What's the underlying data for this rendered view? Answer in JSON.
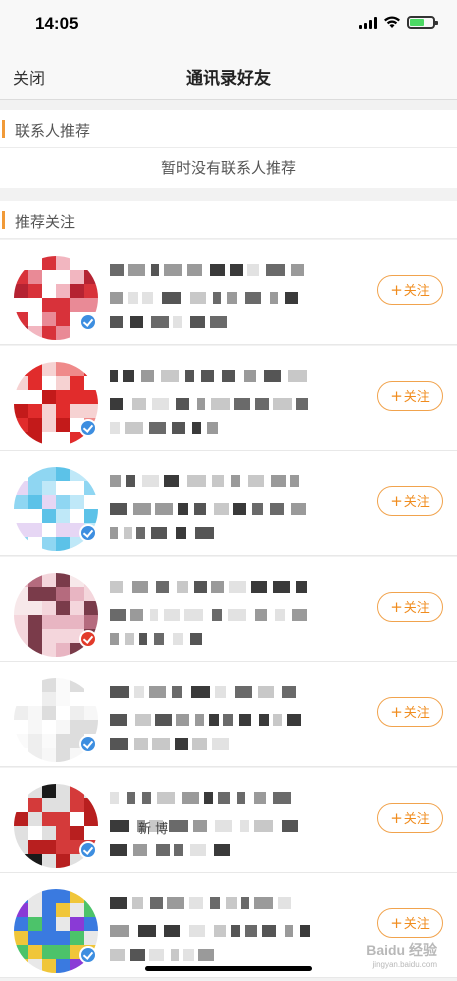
{
  "status_bar": {
    "time": "14:05"
  },
  "nav": {
    "close_label": "关闭",
    "title": "通讯录好友"
  },
  "contacts_section": {
    "title": "联系人推荐",
    "empty_text": "暂时没有联系人推荐"
  },
  "recommend_section": {
    "title": "推荐关注"
  },
  "follow_label": "关注",
  "follow_plus": "+",
  "rows": [
    {
      "name": "(pixelated)",
      "verified": "blue",
      "avatar_colors": [
        "#d8323a",
        "#f2b6c0",
        "#ffffff",
        "#b52332",
        "#e98a96"
      ]
    },
    {
      "name": "(pixelated)",
      "verified": "blue",
      "avatar_colors": [
        "#e12c2c",
        "#ffffff",
        "#f6d2d2",
        "#c31a1a",
        "#ef8a8a"
      ]
    },
    {
      "name": "(pixelated)",
      "verified": "blue",
      "avatar_colors": [
        "#8fd6f2",
        "#ffffff",
        "#bfe8f8",
        "#5cc2e8",
        "#e6d6f4"
      ]
    },
    {
      "name": "(pixelated)",
      "verified": "red",
      "avatar_colors": [
        "#f4d6dc",
        "#7a3b4a",
        "#e8b5c2",
        "#f7e8ea",
        "#b56b7e"
      ]
    },
    {
      "name": "(pixelated)",
      "verified": "blue",
      "avatar_colors": [
        "#ffffff",
        "#eeeeee",
        "#f7f7f7",
        "#dddddd",
        "#fafafa"
      ]
    },
    {
      "name": "(pixelated)",
      "verified": "blue",
      "avatar_colors": [
        "#b81f1f",
        "#ffffff",
        "#1a1a1a",
        "#e0e0e0",
        "#d43a3a"
      ],
      "desc_visible": "新 博"
    },
    {
      "name": "(pixelated)",
      "verified": "blue",
      "avatar_colors": [
        "#f0c63a",
        "#8a3ad6",
        "#3a7ae0",
        "#e8e8e8",
        "#4cc36a"
      ]
    }
  ],
  "watermark": {
    "main": "Baidu 经验",
    "sub": "jingyan.baidu.com"
  },
  "colors": {
    "accent": "#f19a38",
    "follow_text": "#f08c1e",
    "verified_blue": "#3d8ee0",
    "verified_red": "#e23a2a",
    "background": "#f2f2f2"
  }
}
